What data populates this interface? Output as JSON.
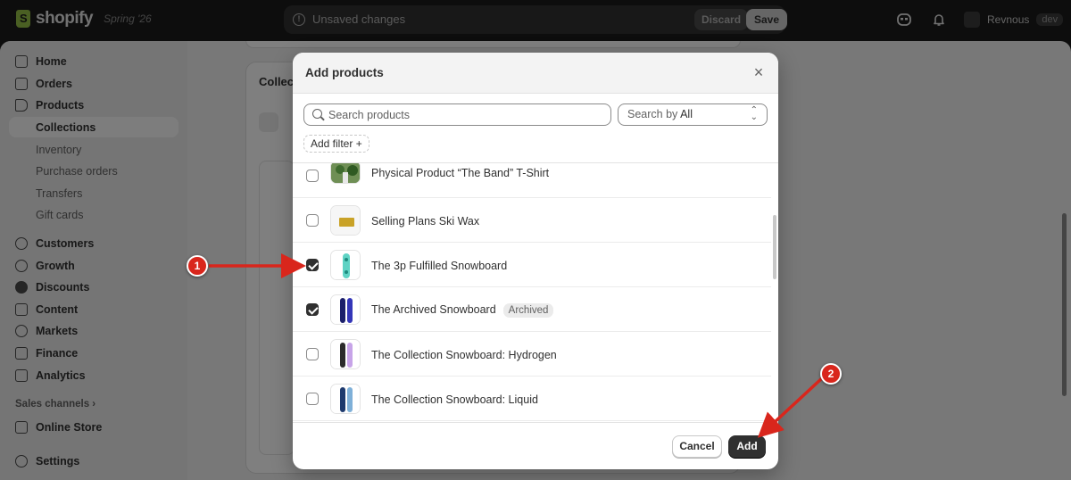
{
  "topbar": {
    "logo_text": "shopify",
    "edition": "Spring '26",
    "unsaved_text": "Unsaved changes",
    "discard_label": "Discard",
    "save_label": "Save",
    "store_name": "Revnous",
    "store_badge": "dev"
  },
  "sidebar": {
    "items": [
      {
        "label": "Home",
        "icon": "home-icon"
      },
      {
        "label": "Orders",
        "icon": "orders-icon"
      },
      {
        "label": "Products",
        "icon": "tag-icon"
      },
      {
        "label": "Collections"
      },
      {
        "label": "Inventory"
      },
      {
        "label": "Purchase orders"
      },
      {
        "label": "Transfers"
      },
      {
        "label": "Gift cards"
      },
      {
        "label": "Customers",
        "icon": "person-icon"
      },
      {
        "label": "Growth",
        "icon": "growth-icon"
      },
      {
        "label": "Discounts",
        "icon": "discount-icon"
      },
      {
        "label": "Content",
        "icon": "content-icon"
      },
      {
        "label": "Markets",
        "icon": "globe-icon"
      },
      {
        "label": "Finance",
        "icon": "bank-icon"
      },
      {
        "label": "Analytics",
        "icon": "chart-icon"
      }
    ],
    "sales_channels_label": "Sales channels",
    "online_store_label": "Online Store",
    "settings_label": "Settings"
  },
  "background": {
    "card_title_partial": "Collec"
  },
  "modal": {
    "title": "Add products",
    "search_placeholder": "Search products",
    "search_by_prefix": "Search by ",
    "search_by_value": "All",
    "add_filter_label": "Add filter +",
    "products": [
      {
        "name": "Physical Product “The Band” T-Shirt",
        "checked": false,
        "badge": ""
      },
      {
        "name": "Selling Plans Ski Wax",
        "checked": false,
        "badge": ""
      },
      {
        "name": "The 3p Fulfilled Snowboard",
        "checked": true,
        "badge": ""
      },
      {
        "name": "The Archived Snowboard",
        "checked": true,
        "badge": "Archived"
      },
      {
        "name": "The Collection Snowboard: Hydrogen",
        "checked": false,
        "badge": ""
      },
      {
        "name": "The Collection Snowboard: Liquid",
        "checked": false,
        "badge": ""
      }
    ],
    "cancel_label": "Cancel",
    "add_label": "Add"
  },
  "annotations": {
    "marker_1": "1",
    "marker_2": "2"
  },
  "colors": {
    "annotation_red": "#d9261c",
    "primary_button": "#303030",
    "topbar_bg": "#1a1a1a"
  }
}
